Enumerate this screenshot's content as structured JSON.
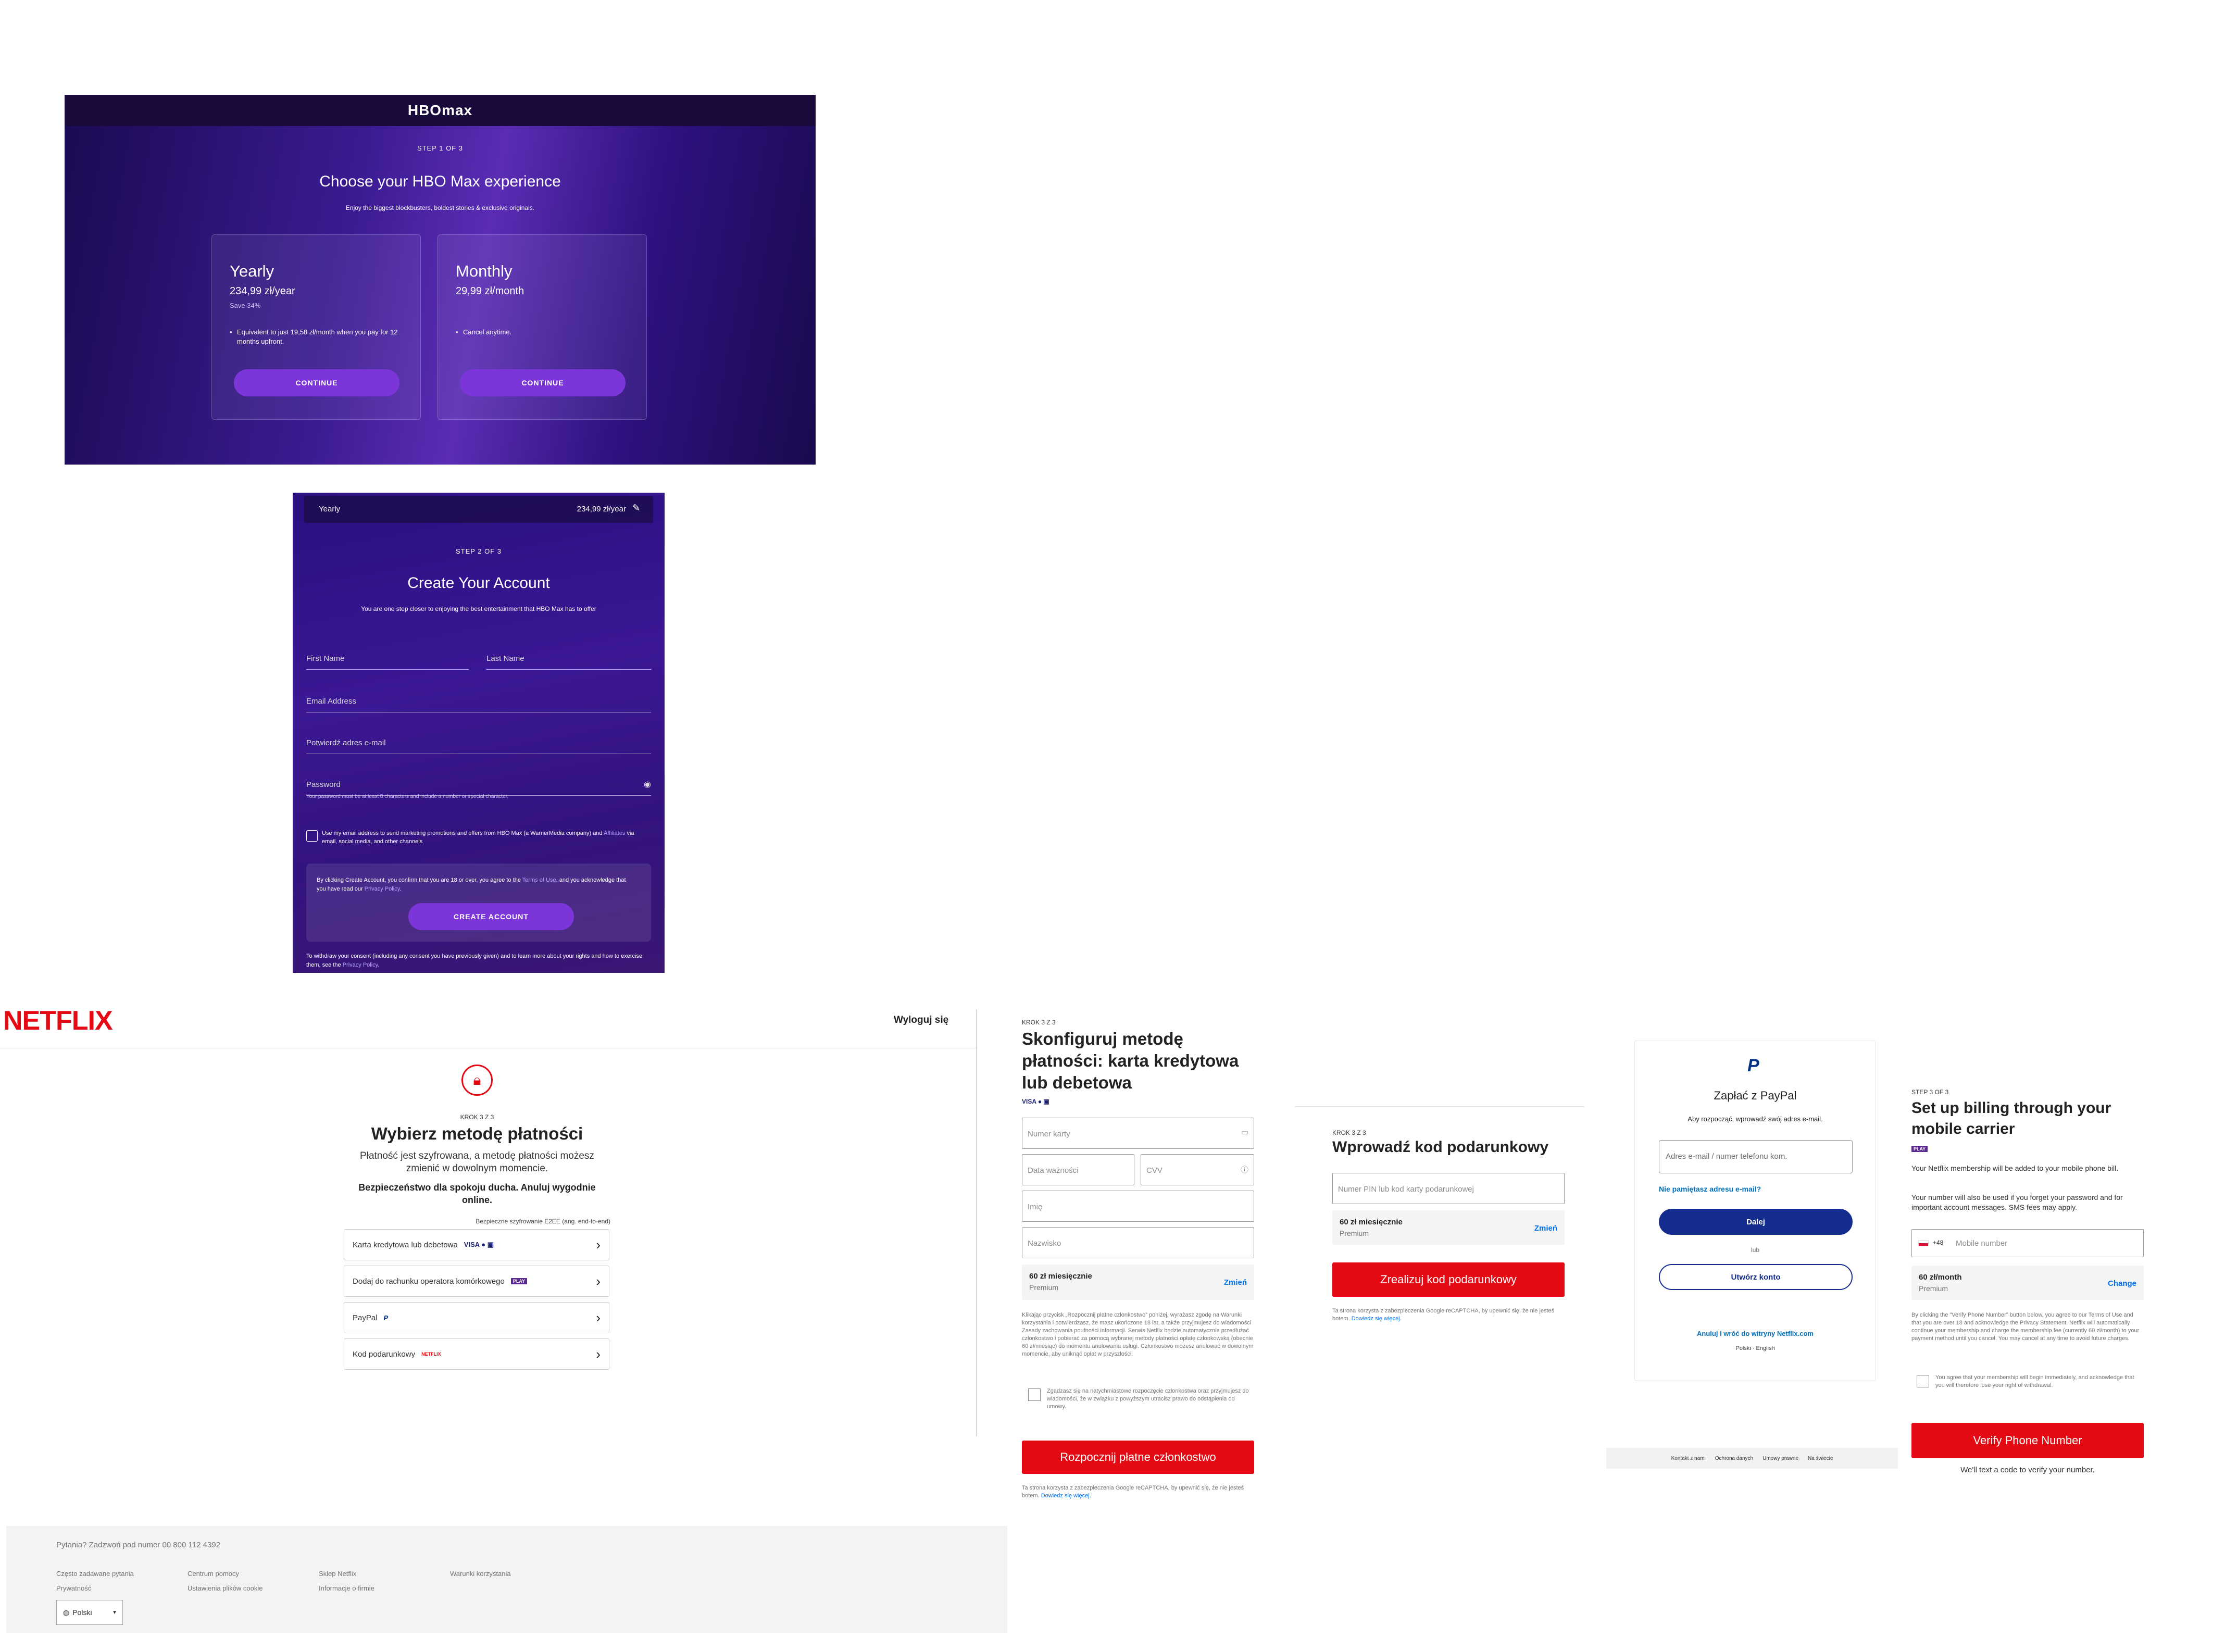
{
  "hbo_plan": {
    "logo": "HBOmax",
    "step": "STEP 1 OF 3",
    "title": "Choose your HBO Max experience",
    "subtitle": "Enjoy the biggest blockbusters, boldest stories & exclusive originals.",
    "plans": [
      {
        "name": "Yearly",
        "price": "234,99 zł/year",
        "save": "Save 34%",
        "bullet": "Equivalent to just 19,58 zł/month when you pay for 12 months upfront.",
        "button": "CONTINUE"
      },
      {
        "name": "Monthly",
        "price": "29,99 zł/month",
        "save": "",
        "bullet": "Cancel anytime.",
        "button": "CONTINUE"
      }
    ]
  },
  "hbo_account": {
    "summary_plan": "Yearly",
    "summary_price": "234,99 zł/year",
    "step": "STEP 2 OF 3",
    "title": "Create Your Account",
    "subtitle": "You are one step closer to enjoying the best entertainment that HBO Max has to offer",
    "fields": {
      "first_name": "First Name",
      "last_name": "Last Name",
      "email": "Email Address",
      "confirm_email": "Potwierdź adres e-mail",
      "password": "Password"
    },
    "password_hint": "Your password must be at least 8 characters and include a number or special character.",
    "marketing_text": "Use my email address to send marketing promotions and offers from HBO Max (a WarnerMedia company) and",
    "marketing_link": "Affiliates",
    "marketing_text2": "via email, social media, and other channels",
    "terms_text": "By clicking Create Account, you confirm that you are 18 or over, you agree to the",
    "terms_link": "Terms of Use",
    "terms_text2": ", and you acknowledge that you have read our",
    "privacy_link": "Privacy Policy",
    "create_button": "CREATE ACCOUNT",
    "footer_text": "To withdraw your consent (including any consent you have previously given) and to learn more about your rights and how to exercise them, see the",
    "footer_link": "Privacy Policy"
  },
  "netflix_header": {
    "logo": "NETFLIX",
    "sign_out": "Wyloguj się"
  },
  "netflix_payment": {
    "step": "KROK 3 Z 3",
    "title": "Wybierz metodę płatności",
    "description": "Płatność jest szyfrowana, a metodę płatności możesz zmienić w dowolnym momencie.",
    "bold": "Bezpieczeństwo dla spokoju ducha. Anuluj wygodnie online.",
    "secure": "Bezpieczne szyfrowanie E2EE (ang. end-to-end)",
    "options": [
      {
        "label": "Karta kredytowa lub debetowa",
        "logos": "VISA ● ▣"
      },
      {
        "label": "Dodaj do rachunku operatora komórkowego",
        "logos": "PLAY"
      },
      {
        "label": "PayPal",
        "logos": "P"
      },
      {
        "label": "Kod podarunkowy",
        "logos": "NETFLIX"
      }
    ]
  },
  "netflix_footer": {
    "question": "Pytania? Zadzwoń pod numer 00 800 112 4392",
    "links": [
      "Często zadawane pytania",
      "Centrum pomocy",
      "Sklep Netflix",
      "Warunki korzystania",
      "Prywatność",
      "Ustawienia plików cookie",
      "Informacje o firmie"
    ],
    "language": "Polski"
  },
  "netflix_card": {
    "step": "KROK 3 Z 3",
    "title": "Skonfiguruj metodę płatności: karta kredytowa lub debetowa",
    "card_logos": "VISA ● ▣",
    "card_number": "Numer karty",
    "expiry": "Data ważności",
    "cvv": "CVV",
    "first_name": "Imię",
    "last_name": "Nazwisko",
    "plan_price": "60 zł miesięcznie",
    "plan_name": "Premium",
    "change": "Zmień",
    "legal": "Klikając przycisk „Rozpocznij płatne członkostwo” poniżej, wyrażasz zgodę na Warunki korzystania i potwierdzasz, że masz ukończone 18 lat, a także przyjmujesz do wiadomości Zasady zachowania poufności informacji. Serwis Netflix będzie automatycznie przedłużać członkostwo i pobierać za pomocą wybranej metody płatności opłatę członkowską (obecnie 60 zł/miesiąc) do momentu anulowania usługi. Członkostwo możesz anulować w dowolnym momencie, aby uniknąć opłat w przyszłości.",
    "consent": "Zgadzasz się na natychmiastowe rozpoczęcie członkostwa oraz przyjmujesz do wiadomości, że w związku z powyższym utracisz prawo do odstąpienia od umowy.",
    "button": "Rozpocznij płatne członkostwo",
    "recaptcha": "Ta strona korzysta z zabezpieczenia Google reCAPTCHA, by upewnić się, że nie jesteś botem.",
    "recaptcha_link": "Dowiedz się więcej."
  },
  "netflix_gift": {
    "step": "KROK 3 Z 3",
    "title": "Wprowadź kod podarunkowy",
    "input": "Numer PIN lub kod karty podarunkowej",
    "plan_price": "60 zł miesięcznie",
    "plan_name": "Premium",
    "change": "Zmień",
    "button": "Zrealizuj kod podarunkowy",
    "recaptcha": "Ta strona korzysta z zabezpieczenia Google reCAPTCHA, by upewnić się, że nie jesteś botem.",
    "recaptcha_link": "Dowiedz się więcej."
  },
  "paypal": {
    "logo": "P",
    "title": "Zapłać z PayPal",
    "subtitle": "Aby rozpocząć, wprowadź swój adres e-mail.",
    "input": "Adres e-mail / numer telefonu kom.",
    "forgot": "Nie pamiętasz adresu e-mail?",
    "next": "Dalej",
    "or": "lub",
    "create": "Utwórz konto",
    "cancel": "Anuluj i wróć do witryny Netflix.com",
    "languages": "Polski · English",
    "footer_links": [
      "Kontakt z nami",
      "Ochrona danych",
      "Umowy prawne",
      "Na świecie"
    ]
  },
  "netflix_carrier": {
    "step": "STEP 3 OF 3",
    "title": "Set up billing through your mobile carrier",
    "carrier": "PLAY",
    "p1": "Your Netflix membership will be added to your mobile phone bill.",
    "p2": "Your number will also be used if you forget your password and for important account messages. SMS fees may apply.",
    "country_code": "+48",
    "phone_placeholder": "Mobile number",
    "plan_price": "60 zł/month",
    "plan_name": "Premium",
    "change": "Change",
    "legal": "By clicking the \"Verify Phone Number\" button below, you agree to our Terms of Use and that you are over 18 and acknowledge the Privacy Statement. Netflix will automatically continue your membership and charge the membership fee (currently 60 zł/month) to your payment method until you cancel. You may cancel at any time to avoid future charges.",
    "consent": "You agree that your membership will begin immediately, and acknowledge that you will therefore lose your right of withdrawal.",
    "button": "Verify Phone Number",
    "note": "We'll text a code to verify your number."
  },
  "colors": {
    "hbo_purple": "#7c35d8",
    "netflix_red": "#e50914",
    "paypal_blue": "#142c8e",
    "link_blue": "#0071eb"
  }
}
